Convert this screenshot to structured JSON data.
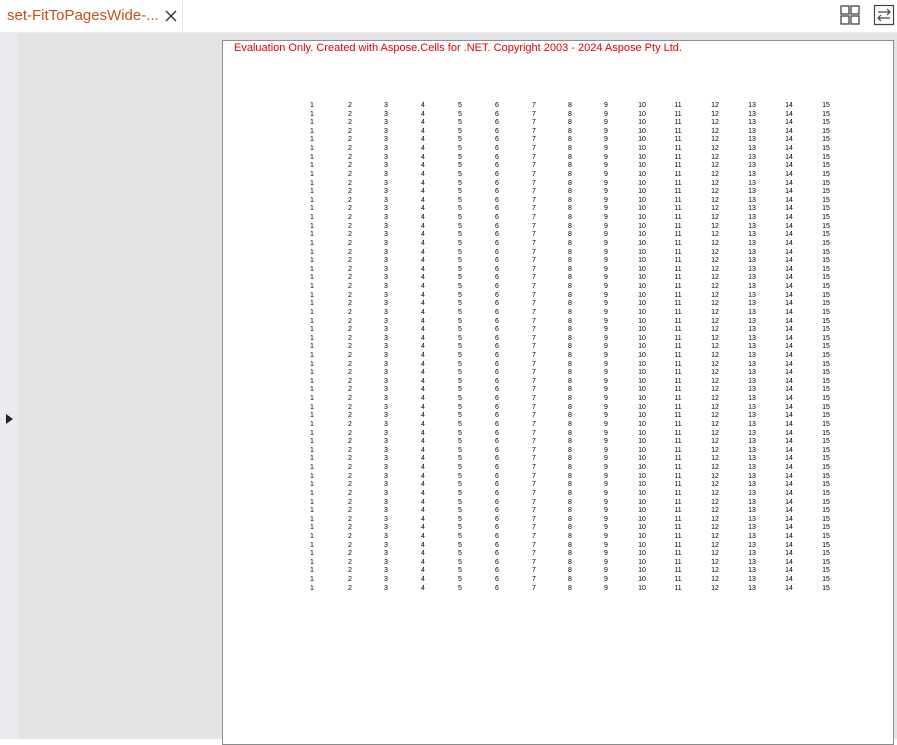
{
  "tab": {
    "title": "set-FitToPagesWide-..."
  },
  "toolbar": {
    "grid_icon": "grid-view-icon",
    "switch_icon": "switch-view-icon"
  },
  "document": {
    "evaluation_notice": "Evaluation Only. Created with Aspose.Cells for .NET. Copyright 2003 - 2024 Aspose Pty Ltd.",
    "row_values": [
      "1",
      "2",
      "3",
      "4",
      "5",
      "6",
      "7",
      "8",
      "9",
      "10",
      "11",
      "12",
      "13",
      "14",
      "15"
    ],
    "row_count": 57
  },
  "colors": {
    "tab_title": "#c4501a",
    "notice": "#e00000"
  }
}
